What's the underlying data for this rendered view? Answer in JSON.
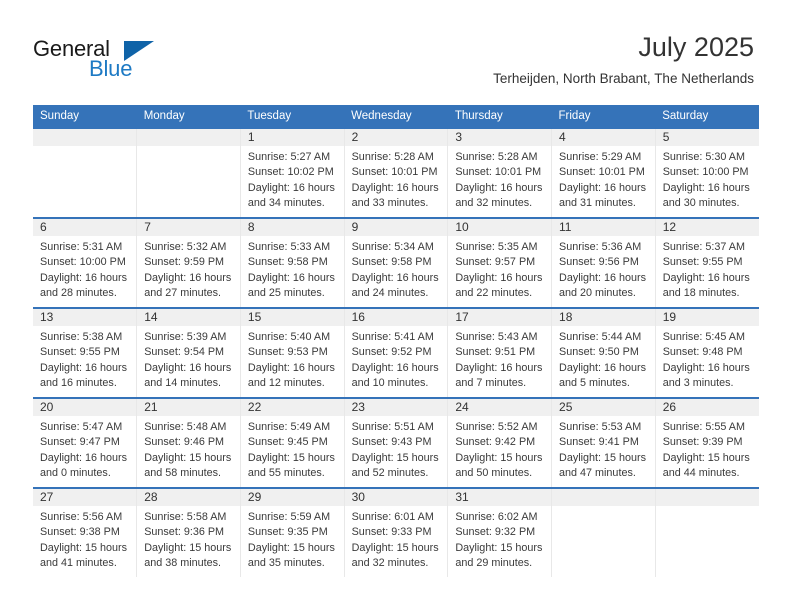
{
  "brand": {
    "name_part1": "General",
    "name_part2": "Blue",
    "accent_color": "#1e7ac4",
    "triangle_color": "#0f63a8"
  },
  "header": {
    "month_year": "July 2025",
    "location": "Terheijden, North Brabant, The Netherlands"
  },
  "theme": {
    "header_row_bg": "#3573b9",
    "daynum_band_bg": "#f0f0f0",
    "cell_bg": "#ffffff",
    "text_color": "#333333"
  },
  "weekdays": [
    "Sunday",
    "Monday",
    "Tuesday",
    "Wednesday",
    "Thursday",
    "Friday",
    "Saturday"
  ],
  "weeks": [
    [
      {
        "day": "",
        "empty": true,
        "sunrise": "",
        "sunset": "",
        "daylight1": "",
        "daylight2": ""
      },
      {
        "day": "",
        "empty": true,
        "sunrise": "",
        "sunset": "",
        "daylight1": "",
        "daylight2": ""
      },
      {
        "day": "1",
        "empty": false,
        "sunrise": "Sunrise: 5:27 AM",
        "sunset": "Sunset: 10:02 PM",
        "daylight1": "Daylight: 16 hours",
        "daylight2": "and 34 minutes."
      },
      {
        "day": "2",
        "empty": false,
        "sunrise": "Sunrise: 5:28 AM",
        "sunset": "Sunset: 10:01 PM",
        "daylight1": "Daylight: 16 hours",
        "daylight2": "and 33 minutes."
      },
      {
        "day": "3",
        "empty": false,
        "sunrise": "Sunrise: 5:28 AM",
        "sunset": "Sunset: 10:01 PM",
        "daylight1": "Daylight: 16 hours",
        "daylight2": "and 32 minutes."
      },
      {
        "day": "4",
        "empty": false,
        "sunrise": "Sunrise: 5:29 AM",
        "sunset": "Sunset: 10:01 PM",
        "daylight1": "Daylight: 16 hours",
        "daylight2": "and 31 minutes."
      },
      {
        "day": "5",
        "empty": false,
        "sunrise": "Sunrise: 5:30 AM",
        "sunset": "Sunset: 10:00 PM",
        "daylight1": "Daylight: 16 hours",
        "daylight2": "and 30 minutes."
      }
    ],
    [
      {
        "day": "6",
        "empty": false,
        "sunrise": "Sunrise: 5:31 AM",
        "sunset": "Sunset: 10:00 PM",
        "daylight1": "Daylight: 16 hours",
        "daylight2": "and 28 minutes."
      },
      {
        "day": "7",
        "empty": false,
        "sunrise": "Sunrise: 5:32 AM",
        "sunset": "Sunset: 9:59 PM",
        "daylight1": "Daylight: 16 hours",
        "daylight2": "and 27 minutes."
      },
      {
        "day": "8",
        "empty": false,
        "sunrise": "Sunrise: 5:33 AM",
        "sunset": "Sunset: 9:58 PM",
        "daylight1": "Daylight: 16 hours",
        "daylight2": "and 25 minutes."
      },
      {
        "day": "9",
        "empty": false,
        "sunrise": "Sunrise: 5:34 AM",
        "sunset": "Sunset: 9:58 PM",
        "daylight1": "Daylight: 16 hours",
        "daylight2": "and 24 minutes."
      },
      {
        "day": "10",
        "empty": false,
        "sunrise": "Sunrise: 5:35 AM",
        "sunset": "Sunset: 9:57 PM",
        "daylight1": "Daylight: 16 hours",
        "daylight2": "and 22 minutes."
      },
      {
        "day": "11",
        "empty": false,
        "sunrise": "Sunrise: 5:36 AM",
        "sunset": "Sunset: 9:56 PM",
        "daylight1": "Daylight: 16 hours",
        "daylight2": "and 20 minutes."
      },
      {
        "day": "12",
        "empty": false,
        "sunrise": "Sunrise: 5:37 AM",
        "sunset": "Sunset: 9:55 PM",
        "daylight1": "Daylight: 16 hours",
        "daylight2": "and 18 minutes."
      }
    ],
    [
      {
        "day": "13",
        "empty": false,
        "sunrise": "Sunrise: 5:38 AM",
        "sunset": "Sunset: 9:55 PM",
        "daylight1": "Daylight: 16 hours",
        "daylight2": "and 16 minutes."
      },
      {
        "day": "14",
        "empty": false,
        "sunrise": "Sunrise: 5:39 AM",
        "sunset": "Sunset: 9:54 PM",
        "daylight1": "Daylight: 16 hours",
        "daylight2": "and 14 minutes."
      },
      {
        "day": "15",
        "empty": false,
        "sunrise": "Sunrise: 5:40 AM",
        "sunset": "Sunset: 9:53 PM",
        "daylight1": "Daylight: 16 hours",
        "daylight2": "and 12 minutes."
      },
      {
        "day": "16",
        "empty": false,
        "sunrise": "Sunrise: 5:41 AM",
        "sunset": "Sunset: 9:52 PM",
        "daylight1": "Daylight: 16 hours",
        "daylight2": "and 10 minutes."
      },
      {
        "day": "17",
        "empty": false,
        "sunrise": "Sunrise: 5:43 AM",
        "sunset": "Sunset: 9:51 PM",
        "daylight1": "Daylight: 16 hours",
        "daylight2": "and 7 minutes."
      },
      {
        "day": "18",
        "empty": false,
        "sunrise": "Sunrise: 5:44 AM",
        "sunset": "Sunset: 9:50 PM",
        "daylight1": "Daylight: 16 hours",
        "daylight2": "and 5 minutes."
      },
      {
        "day": "19",
        "empty": false,
        "sunrise": "Sunrise: 5:45 AM",
        "sunset": "Sunset: 9:48 PM",
        "daylight1": "Daylight: 16 hours",
        "daylight2": "and 3 minutes."
      }
    ],
    [
      {
        "day": "20",
        "empty": false,
        "sunrise": "Sunrise: 5:47 AM",
        "sunset": "Sunset: 9:47 PM",
        "daylight1": "Daylight: 16 hours",
        "daylight2": "and 0 minutes."
      },
      {
        "day": "21",
        "empty": false,
        "sunrise": "Sunrise: 5:48 AM",
        "sunset": "Sunset: 9:46 PM",
        "daylight1": "Daylight: 15 hours",
        "daylight2": "and 58 minutes."
      },
      {
        "day": "22",
        "empty": false,
        "sunrise": "Sunrise: 5:49 AM",
        "sunset": "Sunset: 9:45 PM",
        "daylight1": "Daylight: 15 hours",
        "daylight2": "and 55 minutes."
      },
      {
        "day": "23",
        "empty": false,
        "sunrise": "Sunrise: 5:51 AM",
        "sunset": "Sunset: 9:43 PM",
        "daylight1": "Daylight: 15 hours",
        "daylight2": "and 52 minutes."
      },
      {
        "day": "24",
        "empty": false,
        "sunrise": "Sunrise: 5:52 AM",
        "sunset": "Sunset: 9:42 PM",
        "daylight1": "Daylight: 15 hours",
        "daylight2": "and 50 minutes."
      },
      {
        "day": "25",
        "empty": false,
        "sunrise": "Sunrise: 5:53 AM",
        "sunset": "Sunset: 9:41 PM",
        "daylight1": "Daylight: 15 hours",
        "daylight2": "and 47 minutes."
      },
      {
        "day": "26",
        "empty": false,
        "sunrise": "Sunrise: 5:55 AM",
        "sunset": "Sunset: 9:39 PM",
        "daylight1": "Daylight: 15 hours",
        "daylight2": "and 44 minutes."
      }
    ],
    [
      {
        "day": "27",
        "empty": false,
        "sunrise": "Sunrise: 5:56 AM",
        "sunset": "Sunset: 9:38 PM",
        "daylight1": "Daylight: 15 hours",
        "daylight2": "and 41 minutes."
      },
      {
        "day": "28",
        "empty": false,
        "sunrise": "Sunrise: 5:58 AM",
        "sunset": "Sunset: 9:36 PM",
        "daylight1": "Daylight: 15 hours",
        "daylight2": "and 38 minutes."
      },
      {
        "day": "29",
        "empty": false,
        "sunrise": "Sunrise: 5:59 AM",
        "sunset": "Sunset: 9:35 PM",
        "daylight1": "Daylight: 15 hours",
        "daylight2": "and 35 minutes."
      },
      {
        "day": "30",
        "empty": false,
        "sunrise": "Sunrise: 6:01 AM",
        "sunset": "Sunset: 9:33 PM",
        "daylight1": "Daylight: 15 hours",
        "daylight2": "and 32 minutes."
      },
      {
        "day": "31",
        "empty": false,
        "sunrise": "Sunrise: 6:02 AM",
        "sunset": "Sunset: 9:32 PM",
        "daylight1": "Daylight: 15 hours",
        "daylight2": "and 29 minutes."
      },
      {
        "day": "",
        "empty": true,
        "sunrise": "",
        "sunset": "",
        "daylight1": "",
        "daylight2": ""
      },
      {
        "day": "",
        "empty": true,
        "sunrise": "",
        "sunset": "",
        "daylight1": "",
        "daylight2": ""
      }
    ]
  ]
}
